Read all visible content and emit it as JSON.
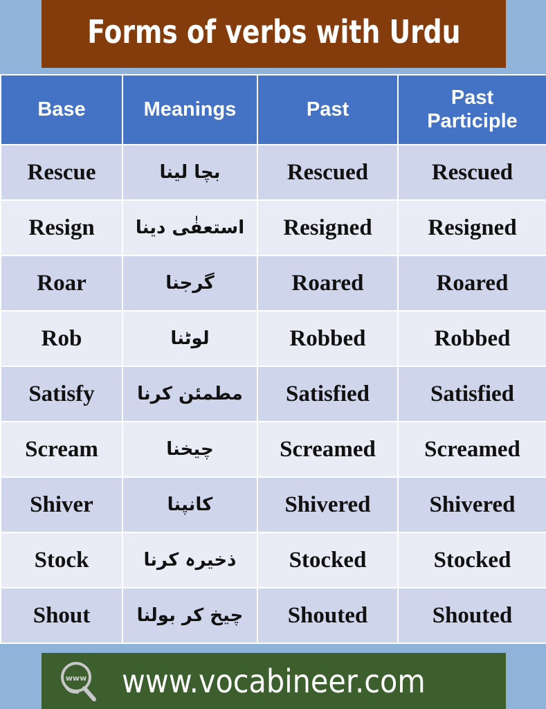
{
  "title": "Forms of verbs with Urdu",
  "table": {
    "headers": [
      "Base",
      "Meanings",
      "Past",
      "Past\nParticiple"
    ],
    "header_lines": {
      "base": "Base",
      "meanings": "Meanings",
      "past": "Past",
      "past_participle_line1": "Past",
      "past_participle_line2": "Participle"
    },
    "rows": [
      {
        "base": "Rescue",
        "meaning": "بچا لینا",
        "past": "Rescued",
        "past_participle": "Rescued"
      },
      {
        "base": "Resign",
        "meaning": "استعفٰی دینا",
        "past": "Resigned",
        "past_participle": "Resigned"
      },
      {
        "base": "Roar",
        "meaning": "گرجنا",
        "past": "Roared",
        "past_participle": "Roared"
      },
      {
        "base": "Rob",
        "meaning": "لوٹنا",
        "past": "Robbed",
        "past_participle": "Robbed"
      },
      {
        "base": "Satisfy",
        "meaning": "مطمئن کرنا",
        "past": "Satisfied",
        "past_participle": "Satisfied"
      },
      {
        "base": "Scream",
        "meaning": "چیخنا",
        "past": "Screamed",
        "past_participle": "Screamed"
      },
      {
        "base": "Shiver",
        "meaning": "کانپنا",
        "past": "Shivered",
        "past_participle": "Shivered"
      },
      {
        "base": "Stock",
        "meaning": "ذخیرہ کرنا",
        "past": "Stocked",
        "past_participle": "Stocked"
      },
      {
        "base": "Shout",
        "meaning": "چیخ کر بولنا",
        "past": "Shouted",
        "past_participle": "Shouted"
      }
    ]
  },
  "footer": {
    "icon": "www-magnifier-icon",
    "icon_label": "www",
    "url_text": "www.vocabineer.com"
  },
  "colors": {
    "title_bg": "#843c0c",
    "header_bg": "#4472c4",
    "row_dark": "#cfd5ea",
    "row_light": "#e9ebf5",
    "footer_bg": "#3d5f2e",
    "page_bg": "#8fb3d9"
  }
}
